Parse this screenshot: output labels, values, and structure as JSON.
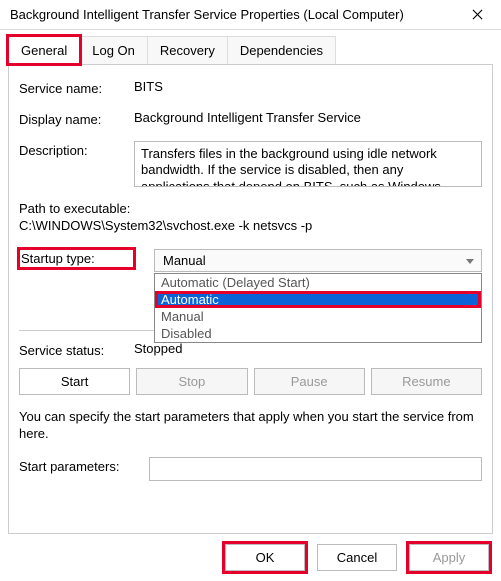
{
  "window": {
    "title": "Background Intelligent Transfer Service Properties (Local Computer)"
  },
  "tabs": {
    "general": "General",
    "logon": "Log On",
    "recovery": "Recovery",
    "dependencies": "Dependencies"
  },
  "labels": {
    "serviceName": "Service name:",
    "displayName": "Display name:",
    "description": "Description:",
    "pathHeader": "Path to executable:",
    "startupType": "Startup type:",
    "serviceStatus": "Service status:",
    "hint": "You can specify the start parameters that apply when you start the service from here.",
    "startParams": "Start parameters:"
  },
  "values": {
    "serviceName": "BITS",
    "displayName": "Background Intelligent Transfer Service",
    "description": "Transfers files in the background using idle network bandwidth. If the service is disabled, then any applications that depend on BITS, such as Windows",
    "path": "C:\\WINDOWS\\System32\\svchost.exe -k netsvcs -p",
    "startupSelected": "Manual",
    "serviceStatus": "Stopped",
    "startParams": ""
  },
  "startupOptions": {
    "o0": "Automatic (Delayed Start)",
    "o1": "Automatic",
    "o2": "Manual",
    "o3": "Disabled"
  },
  "buttons": {
    "start": "Start",
    "stop": "Stop",
    "pause": "Pause",
    "resume": "Resume",
    "ok": "OK",
    "cancel": "Cancel",
    "apply": "Apply"
  }
}
